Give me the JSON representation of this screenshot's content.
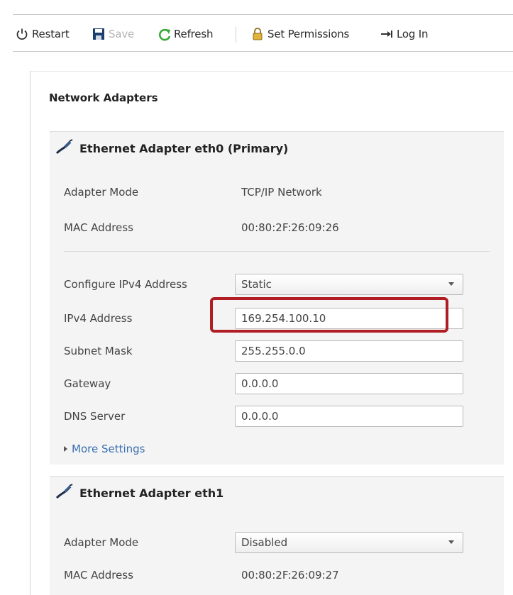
{
  "toolbar": {
    "restart": "Restart",
    "save": "Save",
    "refresh": "Refresh",
    "set_permissions": "Set Permissions",
    "log_in": "Log In"
  },
  "page_title": "Network Adapters",
  "adapters": [
    {
      "title": "Ethernet Adapter eth0 (Primary)",
      "adapter_mode_label": "Adapter Mode",
      "adapter_mode_value": "TCP/IP Network",
      "mac_label": "MAC Address",
      "mac_value": "00:80:2F:26:09:26",
      "configure_label": "Configure IPv4 Address",
      "configure_value": "Static",
      "ipv4_label": "IPv4 Address",
      "ipv4_value": "169.254.100.10",
      "subnet_label": "Subnet Mask",
      "subnet_value": "255.255.0.0",
      "gateway_label": "Gateway",
      "gateway_value": "0.0.0.0",
      "dns_label": "DNS Server",
      "dns_value": "0.0.0.0",
      "more_settings": "More Settings"
    },
    {
      "title": "Ethernet Adapter eth1",
      "adapter_mode_label": "Adapter Mode",
      "adapter_mode_value": "Disabled",
      "mac_label": "MAC Address",
      "mac_value": "00:80:2F:26:09:27"
    }
  ],
  "colors": {
    "highlight_border": "#b01e23",
    "link": "#3a6fb0",
    "refresh_icon": "#3aa83a"
  },
  "icons": [
    "power-icon",
    "save-icon",
    "refresh-icon",
    "lock-icon",
    "login-arrow-icon",
    "network-cable-icon",
    "caret-down-icon",
    "expand-triangle-icon"
  ]
}
